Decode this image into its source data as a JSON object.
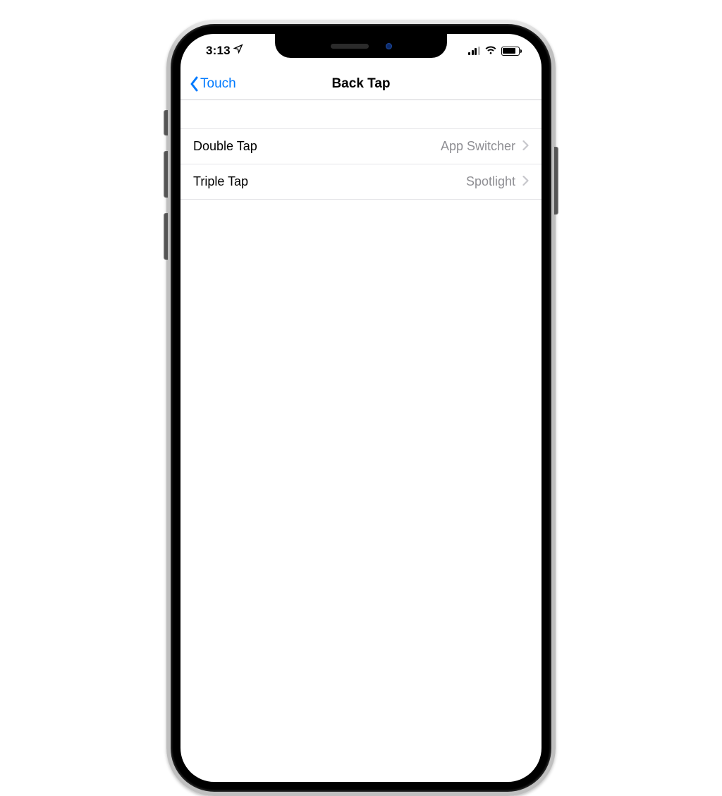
{
  "status": {
    "time": "3:13",
    "location_icon": "location-arrow"
  },
  "nav": {
    "back_label": "Touch",
    "title": "Back Tap"
  },
  "rows": [
    {
      "label": "Double Tap",
      "value": "App Switcher"
    },
    {
      "label": "Triple Tap",
      "value": "Spotlight"
    }
  ]
}
